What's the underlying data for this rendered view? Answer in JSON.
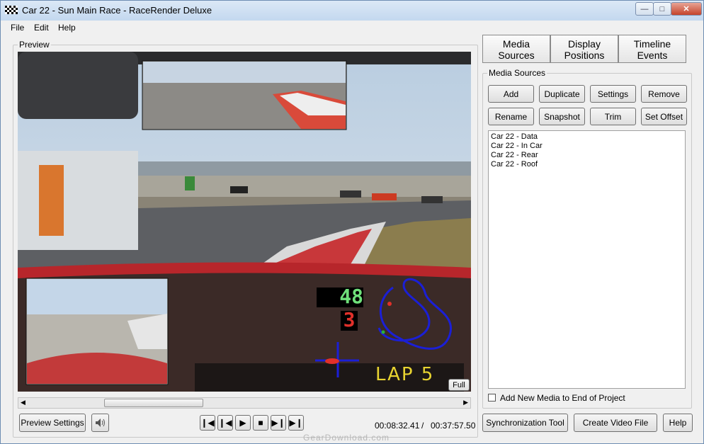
{
  "window": {
    "title": "Car 22 - Sun Main Race - RaceRender Deluxe"
  },
  "menu": {
    "file": "File",
    "edit": "Edit",
    "help": "Help"
  },
  "preview": {
    "label": "Preview",
    "full_button": "Full",
    "speed": "48",
    "gear": "3",
    "lap": "LAP 5"
  },
  "tabs": {
    "media_sources": [
      "Media",
      "Sources"
    ],
    "display_positions": [
      "Display",
      "Positions"
    ],
    "timeline_events": [
      "Timeline",
      "Events"
    ]
  },
  "media": {
    "group_label": "Media Sources",
    "buttons": {
      "add": "Add",
      "duplicate": "Duplicate",
      "settings": "Settings",
      "remove": "Remove",
      "rename": "Rename",
      "snapshot": "Snapshot",
      "trim": "Trim",
      "set_offset": "Set Offset"
    },
    "items": [
      "Car 22 - Data",
      "Car 22 - In Car",
      "Car 22 - Rear",
      "Car 22 - Roof"
    ],
    "add_to_end_label": "Add New Media to End of Project",
    "add_to_end_checked": false
  },
  "playback": {
    "preview_settings": "Preview Settings",
    "current_time": "00:08:32.41",
    "separator": "/",
    "total_time": "00:37:57.50",
    "position_fraction": 0.225
  },
  "bottom": {
    "sync_tool": "Synchronization Tool",
    "create_video": "Create Video File",
    "help": "Help"
  },
  "watermark": "GearDownload.com",
  "colors": {
    "speed": "#6fe07a",
    "gear": "#e0302a",
    "lap": "#e8d430",
    "track": "#1b1fd6"
  }
}
